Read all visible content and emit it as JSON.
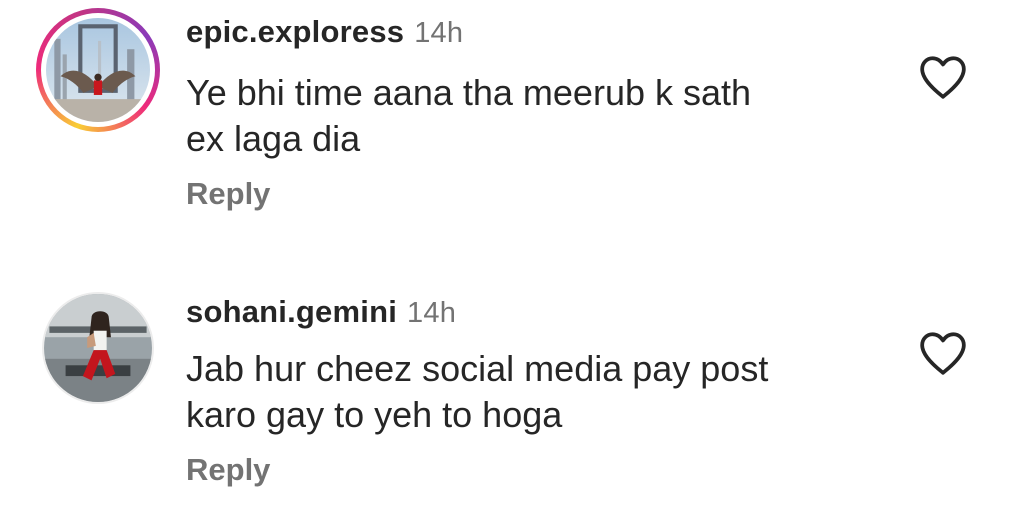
{
  "comments": [
    {
      "username": "epic.exploress",
      "time": "14h",
      "text_line1": "Ye bhi time aana tha meerub k sath",
      "text_line2": "ex laga dia",
      "reply_label": "Reply",
      "avatar_icon": "user-avatar-with-story-ring",
      "like_icon": "heart-outline-icon"
    },
    {
      "username": "sohani.gemini",
      "time": "14h",
      "text_line1": "Jab hur cheez social media pay post",
      "text_line2": "karo gay to yeh to hoga",
      "reply_label": "Reply",
      "avatar_icon": "user-avatar",
      "like_icon": "heart-outline-icon"
    }
  ],
  "colors": {
    "text_primary": "#262626",
    "text_secondary": "#737373",
    "story_ring": [
      "#f9ce34",
      "#ee2a7b",
      "#8a3ab9"
    ]
  }
}
